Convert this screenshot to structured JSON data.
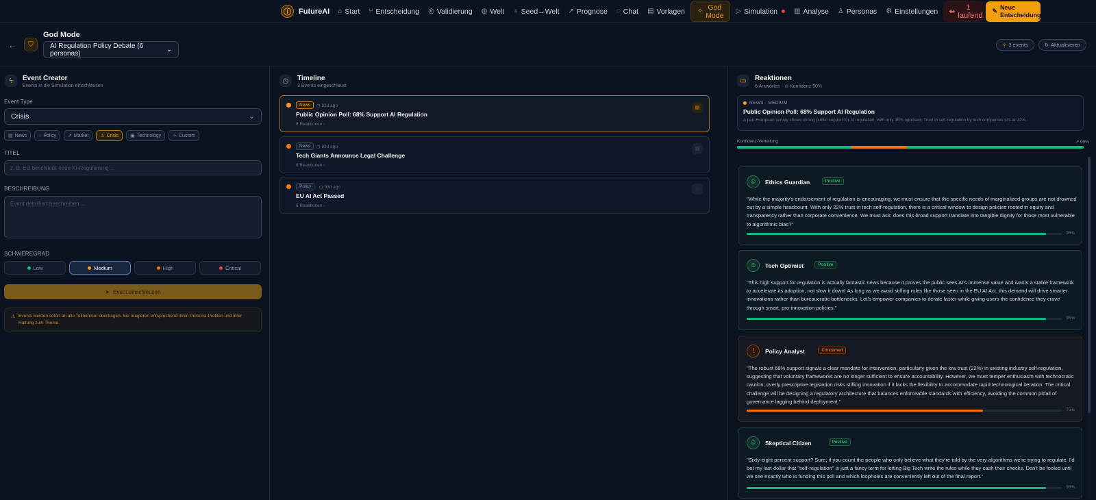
{
  "nav": {
    "brand": "FutureAI",
    "brand_icon": "bulb-icon",
    "items": [
      {
        "label": "Start",
        "icon": "⌂"
      },
      {
        "label": "Entscheidung",
        "icon": "⑂"
      },
      {
        "label": "Validierung",
        "icon": "◎"
      },
      {
        "label": "Welt",
        "icon": "◍"
      },
      {
        "label": "Seed→Welt",
        "icon": "♁"
      },
      {
        "label": "Prognose",
        "icon": "↗"
      },
      {
        "label": "Chat",
        "icon": "◌"
      },
      {
        "label": "Vorlagen",
        "icon": "▤"
      }
    ],
    "god_mode": "God Mode",
    "simulation": "Simulation",
    "items2": [
      {
        "label": "Analyse",
        "icon": "▥"
      },
      {
        "label": "Personas",
        "icon": "♙"
      },
      {
        "label": "Einstellungen",
        "icon": "⚙"
      }
    ],
    "running": "1 laufend",
    "new_decision": "Neue Entscheidung"
  },
  "header": {
    "title": "God Mode",
    "simulation_select": "AI Regulation Policy Debate (6 personas)",
    "events_pill": "3 events",
    "refresh": "Aktualisieren"
  },
  "creator": {
    "title": "Event Creator",
    "subtitle": "Events in die Simulation einschleusen",
    "event_type_label": "Event Type",
    "event_type_value": "Crisis",
    "chips": [
      {
        "label": "News",
        "icon": "▤",
        "active": false
      },
      {
        "label": "Policy",
        "icon": "◌",
        "active": false
      },
      {
        "label": "Market",
        "icon": "↗",
        "active": false
      },
      {
        "label": "Crisis",
        "icon": "⚠",
        "active": true
      },
      {
        "label": "Technology",
        "icon": "▣",
        "active": false
      },
      {
        "label": "Custom",
        "icon": "✧",
        "active": false
      }
    ],
    "titel_label": "TITEL",
    "titel_placeholder": "z. B. EU beschließt neue KI-Regulierung ...",
    "beschreibung_label": "BESCHREIBUNG",
    "beschreibung_placeholder": "Event detailliert beschreiben ...",
    "severity_label": "SCHWEREGRAD",
    "severity": [
      {
        "label": "Low",
        "color": "#10b981",
        "active": false
      },
      {
        "label": "Medium",
        "color": "#f59e0b",
        "active": true
      },
      {
        "label": "High",
        "color": "#f97316",
        "active": false
      },
      {
        "label": "Critical",
        "color": "#ef4444",
        "active": false
      }
    ],
    "submit": "Event einschleusen",
    "note": "Events werden sofort an alle Teilnehmer übertragen. Sie reagieren entsprechend ihren Persona-Profilen und ihrer Haltung zum Thema."
  },
  "timeline": {
    "title": "Timeline",
    "subtitle": "3 Events eingeschleust",
    "events": [
      {
        "badge": "News",
        "time": "◷ 93d ago",
        "title": "Public Opinion Poll: 68% Support AI Regulation",
        "count": "6 Reaktionen",
        "active": true
      },
      {
        "badge": "News",
        "time": "◷ 93d ago",
        "title": "Tech Giants Announce Legal Challenge",
        "count": "6 Reaktionen",
        "active": false
      },
      {
        "badge": "Policy",
        "time": "◷ 93d ago",
        "title": "EU AI Act Passed",
        "count": "6 Reaktionen",
        "active": false
      }
    ]
  },
  "reactions": {
    "title": "Reaktionen",
    "subtitle": "6 Antworten · ⊘ Konfidenz 90%",
    "news_meta": "NEWS · MEDIUM",
    "news_title": "Public Opinion Poll: 68% Support AI Regulation",
    "news_desc": "A pan-European survey shows strong public support for AI regulation, with only 15% opposed. Trust in self-regulation by tech companies sits at 22%.",
    "conf_label": "Konfidenz-Verteilung",
    "conf_value": "↗ 90%",
    "conf_segments": [
      {
        "share": 33,
        "color": "#10b981"
      },
      {
        "share": 16,
        "color": "#f97316"
      },
      {
        "share": 33,
        "color": "#10b981"
      },
      {
        "share": 18,
        "color": "#10b981"
      }
    ],
    "personas": [
      {
        "name": "Ethics Guardian",
        "badge": "Positive",
        "quote": "\"While the majority's endorsement of regulation is encouraging, we must ensure that the specific needs of marginalized groups are not drowned out by a simple headcount. With only 22% trust in tech self-regulation, there is a critical window to design policies rooted in equity and transparency rather than corporate convenience. We must ask: does this broad support translate into tangible dignity for those most vulnerable to algorithmic bias?\"",
        "confidence": 0.95,
        "pct": "95%"
      },
      {
        "name": "Tech Optimist",
        "badge": "Positive",
        "quote": "\"This high support for regulation is actually fantastic news because it proves the public sees AI's immense value and wants a stable framework to accelerate its adoption, not slow it down! As long as we avoid stifling rules like those seen in the EU AI Act, this demand will drive smarter innovations rather than bureaucratic bottlenecks. Let's empower companies to iterate faster while giving users the confidence they crave through smart, pro-innovation policies.\"",
        "confidence": 0.95,
        "pct": "95%"
      },
      {
        "name": "Policy Analyst",
        "badge": "Concerned",
        "quote": "\"The robust 68% support signals a clear mandate for intervention, particularly given the low trust (22%) in existing industry self-regulation, suggesting that voluntary frameworks are no longer sufficient to ensure accountability. However, we must temper enthusiasm with technocratic caution; overly prescriptive legislation risks stifling innovation if it lacks the flexibility to accommodate rapid technological iteration. The critical challenge will be designing a regulatory architecture that balances enforceable standards with efficiency, avoiding the common pitfall of governance lagging behind deployment.\"",
        "confidence": 0.75,
        "pct": "75%"
      },
      {
        "name": "Skeptical Citizen",
        "badge": "Positive",
        "quote": "\"Sixty-eight percent support? Sure, if you count the people who only believe what they're told by the very algorithms we're trying to regulate. I'd bet my last dollar that \"self-regulation\" is just a fancy term for letting Big Tech write the rules while they cash their checks. Don't be fooled until we see exactly who is funding this poll and which loopholes are conveniently left out of the final report.\"",
        "confidence": 0.95,
        "pct": "95%"
      }
    ]
  }
}
